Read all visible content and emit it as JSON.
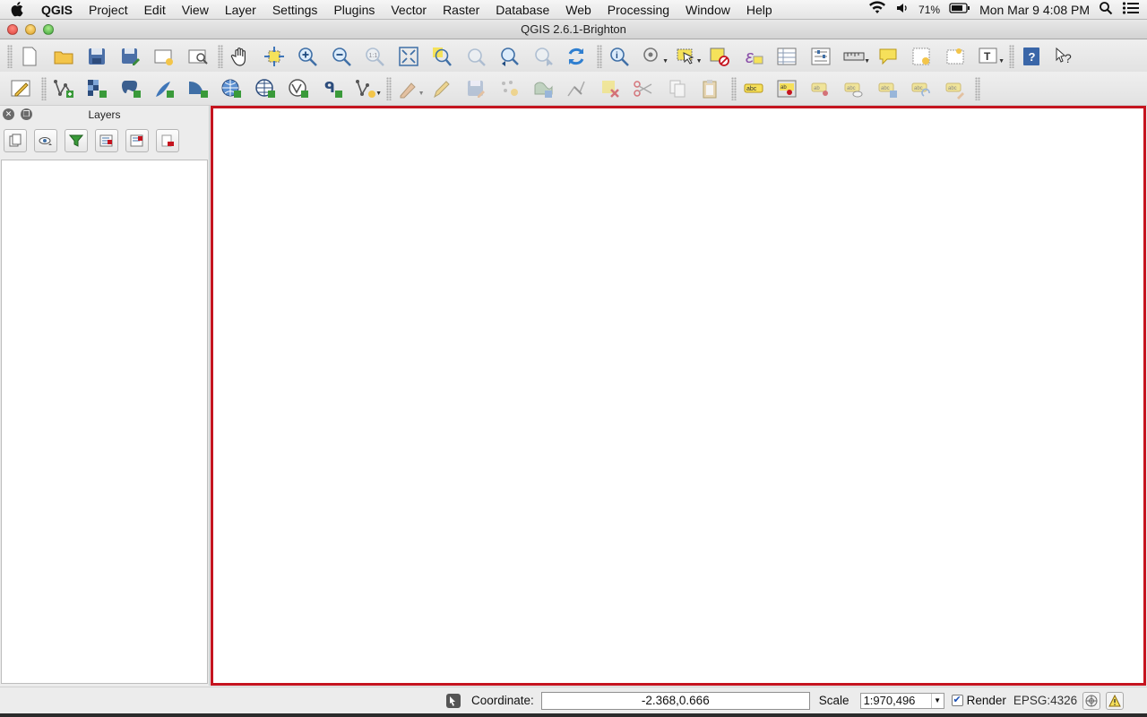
{
  "menubar": {
    "app_name": "QGIS",
    "items": [
      "Project",
      "Edit",
      "View",
      "Layer",
      "Settings",
      "Plugins",
      "Vector",
      "Raster",
      "Database",
      "Web",
      "Processing",
      "Window",
      "Help"
    ],
    "battery": "71%",
    "clock": "Mon Mar 9  4:08 PM"
  },
  "window": {
    "title": "QGIS 2.6.1-Brighton"
  },
  "layers_panel": {
    "title": "Layers"
  },
  "statusbar": {
    "coordinate_label": "Coordinate:",
    "coordinate_value": "-2.368,0.666",
    "scale_label": "Scale",
    "scale_value": "1:970,496",
    "render_label": "Render",
    "render_checked": true,
    "crs": "EPSG:4326"
  },
  "colors": {
    "canvas_border": "#c5141f"
  }
}
